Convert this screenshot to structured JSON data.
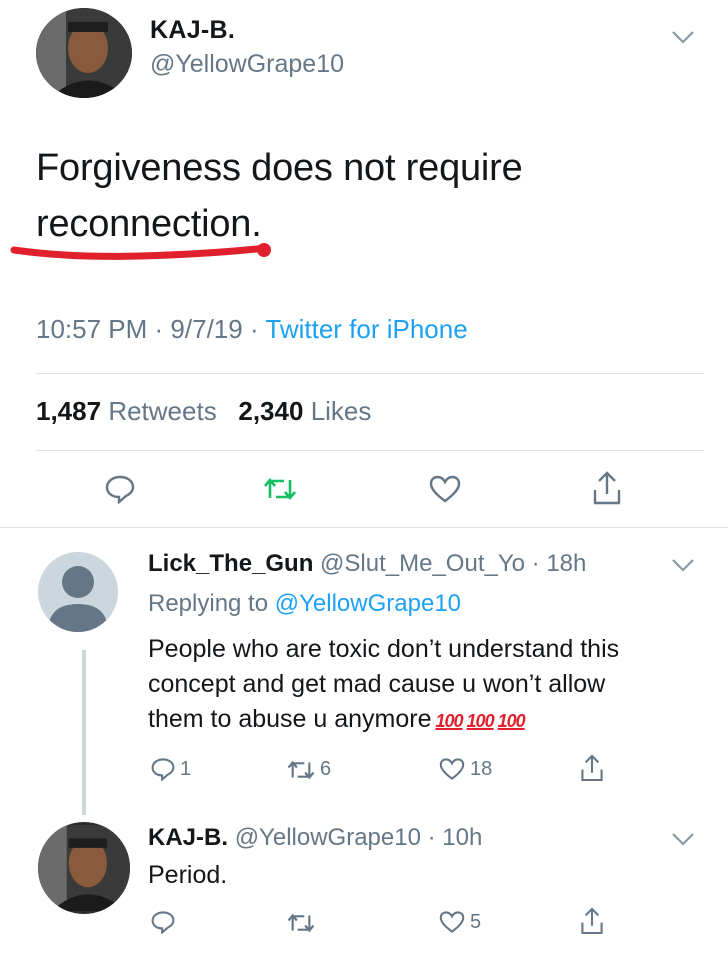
{
  "tweet": {
    "author_name": "KAJ-B.",
    "author_handle": "@YellowGrape10",
    "text_line1": "Forgiveness does not require",
    "text_line2": "reconnection.",
    "time": "10:57 PM",
    "date": "9/7/19",
    "source": "Twitter for iPhone",
    "retweets_count": "1,487",
    "retweets_label": "Retweets",
    "likes_count": "2,340",
    "likes_label": "Likes"
  },
  "replies": [
    {
      "name": "Lick_The_Gun",
      "handle": "@Slut_Me_Out_Yo",
      "age": "18h",
      "replying_label": "Replying to",
      "replying_handle": "@YellowGrape10",
      "line1": "People who are toxic don’t understand this",
      "line2": "concept and get mad cause u won’t allow",
      "line3": "them to abuse u anymore",
      "emoji": "100",
      "reply_count": "1",
      "retweet_count": "6",
      "like_count": "18"
    },
    {
      "name": "KAJ-B.",
      "handle": "@YellowGrape10",
      "age": "10h",
      "text": "Period.",
      "like_count": "5"
    }
  ],
  "separator": "·",
  "colors": {
    "accent": "#1da1f2",
    "retweet_green": "#17bf63",
    "secondary_text": "#657786",
    "underline_red": "#e0202d"
  },
  "icons": [
    "reply-icon",
    "retweet-icon",
    "like-icon",
    "share-icon",
    "chevron-down-icon"
  ]
}
